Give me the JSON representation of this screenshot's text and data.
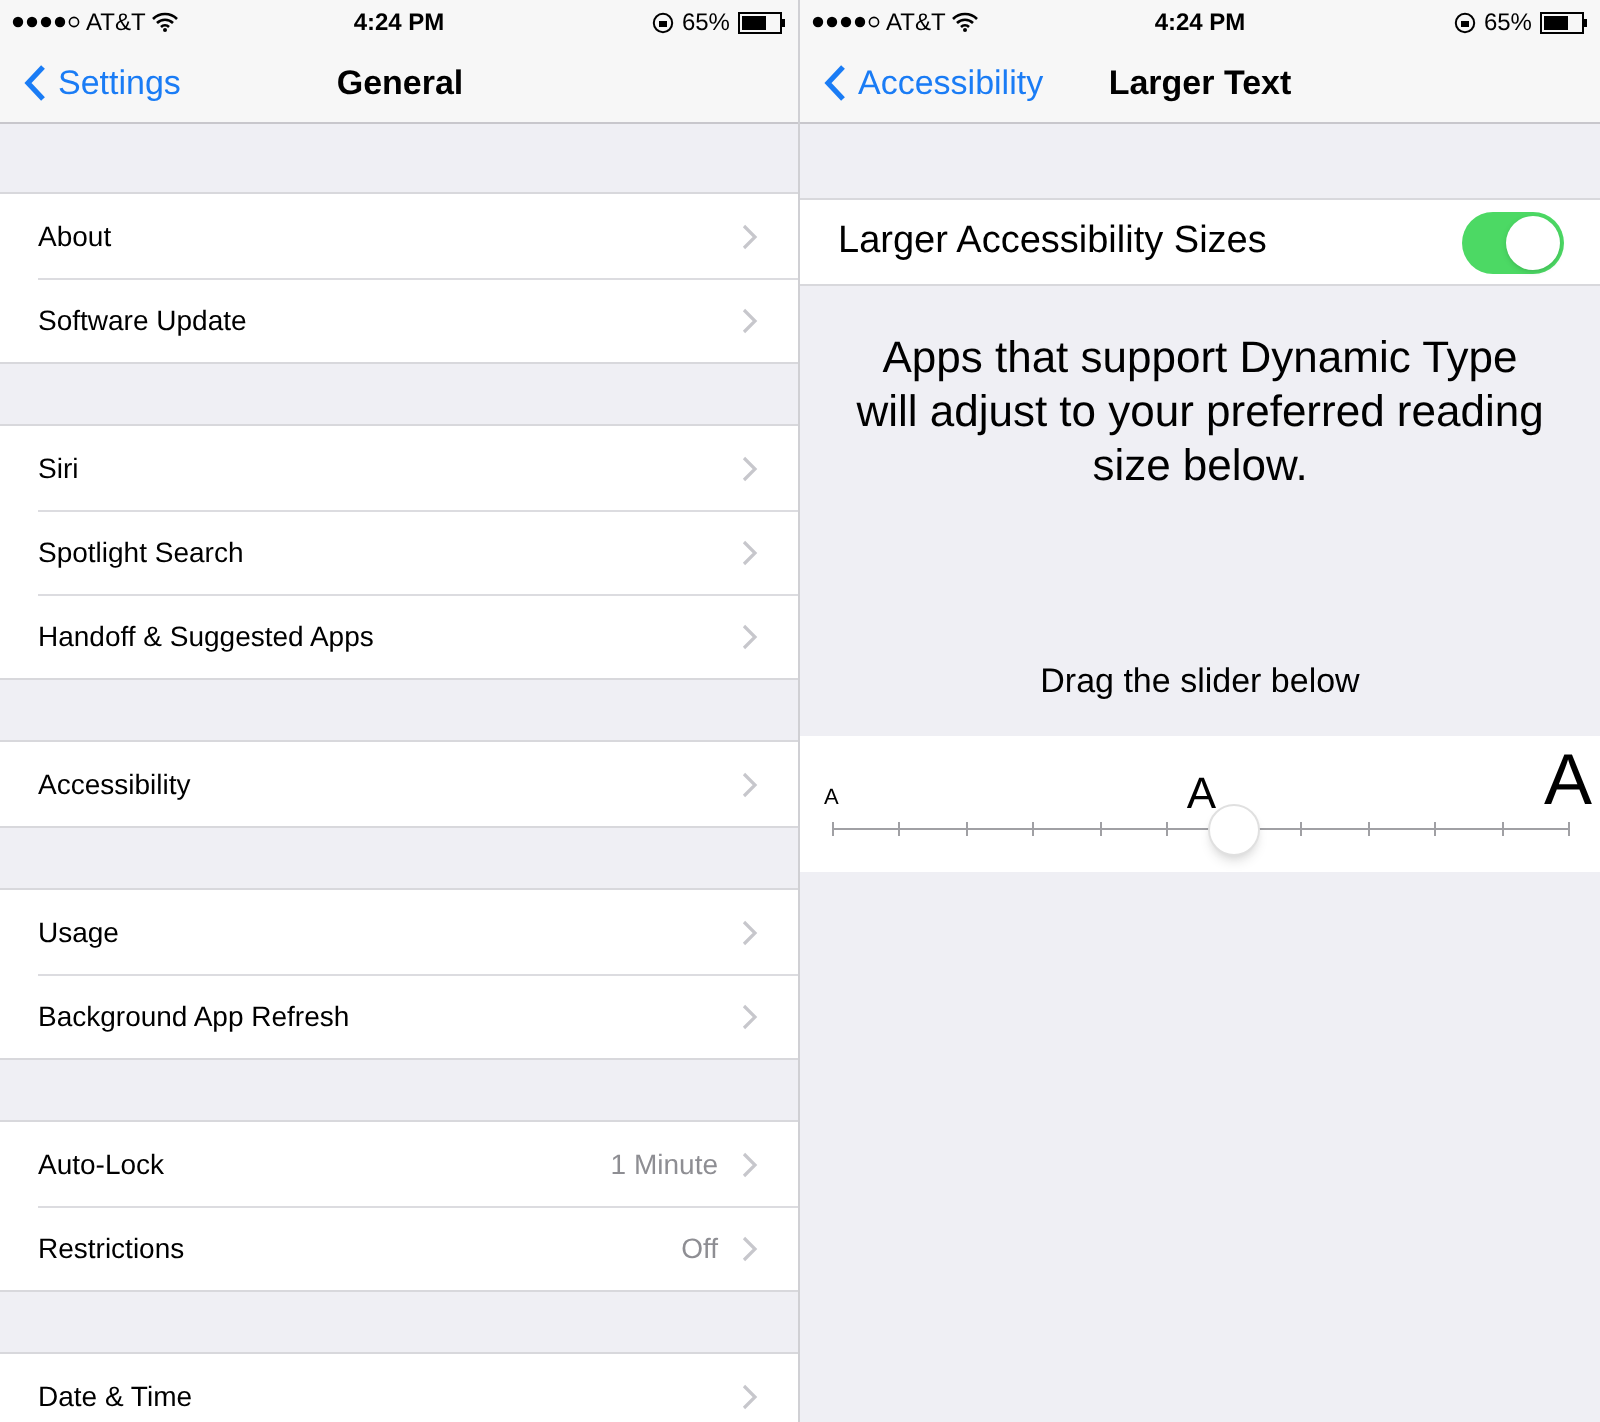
{
  "general_screen": {
    "status_bar": {
      "carrier": "AT&T",
      "time": "4:24 PM",
      "battery": "65%"
    },
    "nav": {
      "back": "Settings",
      "title": "General"
    },
    "groups": [
      [
        {
          "label": "About"
        },
        {
          "label": "Software Update"
        }
      ],
      [
        {
          "label": "Siri"
        },
        {
          "label": "Spotlight Search"
        },
        {
          "label": "Handoff & Suggested Apps"
        }
      ],
      [
        {
          "label": "Accessibility"
        }
      ],
      [
        {
          "label": "Usage"
        },
        {
          "label": "Background App Refresh"
        }
      ],
      [
        {
          "label": "Auto-Lock",
          "value": "1 Minute"
        },
        {
          "label": "Restrictions",
          "value": "Off"
        }
      ],
      [
        {
          "label": "Date & Time"
        }
      ]
    ]
  },
  "larger_text_screen": {
    "status_bar": {
      "carrier": "AT&T",
      "time": "4:24 PM",
      "battery": "65%"
    },
    "nav": {
      "back": "Accessibility",
      "title": "Larger Text"
    },
    "toggle": {
      "label": "Larger Accessibility Sizes",
      "on": true
    },
    "description": "Apps that support Dynamic Type will adjust to your preferred reading size below.",
    "hint": "Drag the slider below",
    "slider": {
      "small_label": "A",
      "mid_label": "A",
      "large_label": "A",
      "level": 0.545
    }
  }
}
